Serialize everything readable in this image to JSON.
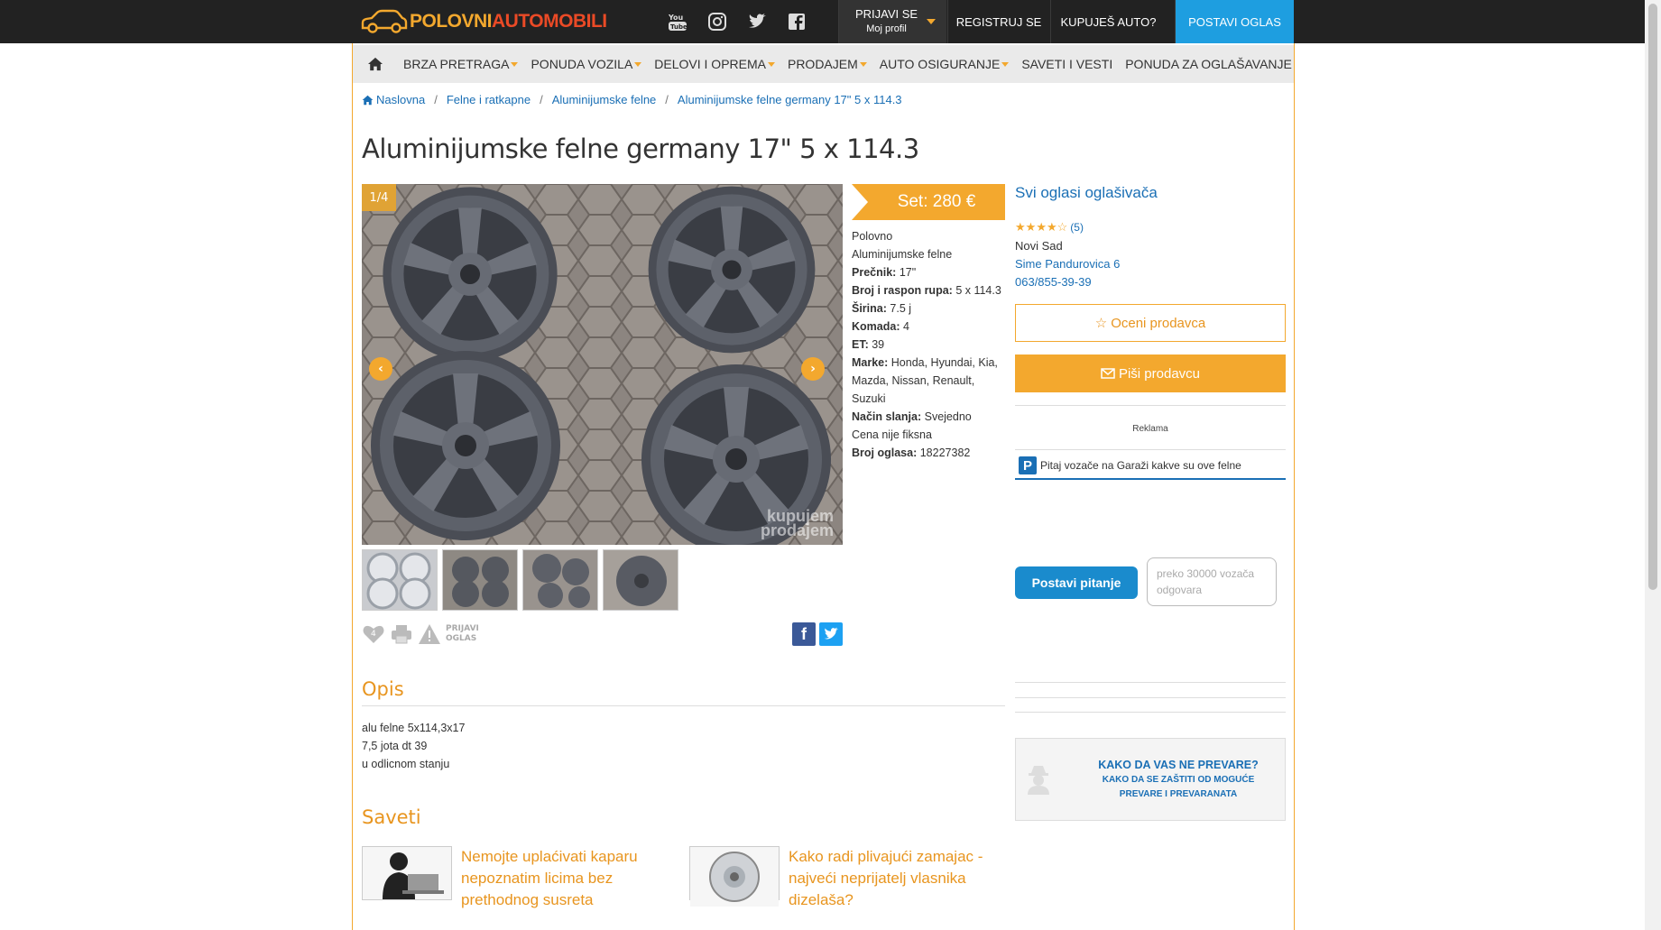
{
  "header": {
    "logo_main": "POLOVNI",
    "logo_accent": "AUTOMOBILI",
    "login_label": "PRIJAVI SE",
    "login_sub": "Moj profil",
    "register_label": "REGISTRUJ SE",
    "buy_label": "KUPUJEŠ AUTO?",
    "post_label": "POSTAVI OGLAS",
    "social_icons": [
      "youtube-icon",
      "instagram-icon",
      "twitter-icon",
      "facebook-icon"
    ]
  },
  "nav": {
    "items": [
      {
        "label": "BRZA PRETRAGA",
        "caret": true
      },
      {
        "label": "PONUDA VOZILA",
        "caret": true
      },
      {
        "label": "DELOVI I OPREMA",
        "caret": true
      },
      {
        "label": "PRODAJEM",
        "caret": true
      },
      {
        "label": "AUTO OSIGURANJE",
        "caret": true
      },
      {
        "label": "SAVETI I VESTI",
        "caret": false
      },
      {
        "label": "PONUDA ZA OGLAŠAVANJE",
        "caret": false
      }
    ]
  },
  "breadcrumb": [
    "Naslovna",
    "Felne i ratkapne",
    "Aluminijumske felne",
    "Aluminijumske felne germany 17\" 5 x 114.3"
  ],
  "title": "Aluminijumske felne germany 17\" 5 x 114.3",
  "gallery": {
    "counter": "1/4",
    "watermark_1": "kupujem",
    "watermark_2": "prodajem",
    "thumb_count": 4
  },
  "tools": {
    "report_1": "PRIJAVI",
    "report_2": "OGLAS"
  },
  "price": "Set: 280 €",
  "details": {
    "condition": "Polovno",
    "category": "Aluminijumske felne",
    "rows": [
      {
        "k": "Prečnik:",
        "v": "17\""
      },
      {
        "k": "Broj i raspon rupa:",
        "v": "5 x 114.3"
      },
      {
        "k": "Širina:",
        "v": "7.5 j"
      },
      {
        "k": "Komada:",
        "v": "4"
      },
      {
        "k": "ET:",
        "v": "39"
      },
      {
        "k": "Marke:",
        "v": "Honda, Hyundai, Kia, Mazda, Nissan, Renault, Suzuki"
      },
      {
        "k": "Način slanja:",
        "v": "Svejedno"
      }
    ],
    "fixed": "Cena nije fiksna",
    "ad_label": "Broj oglasa:",
    "ad_number": "18227382"
  },
  "seller": {
    "all_ads": "Svi oglasi oglašivača",
    "rating": 4,
    "rating_count": "(5)",
    "city": "Novi Sad",
    "address": "Sime Pandurovica 6",
    "phone": "063/855-39-39",
    "rate_label": "Oceni prodavca",
    "write_label": "Piši prodavcu",
    "ad_label": "Reklama",
    "garage_text": "Pitaj vozače na Garaži kakve su ove felne",
    "ask_label": "Postavi pitanje",
    "ask_note": "preko 30000 vozača odgovara",
    "warn_title": "KAKO DA VAS NE PREVARE?",
    "warn_sub": "KAKO DA SE ZAŠTITI OD MOGUĆE PREVARE I PREVARANATA"
  },
  "description": {
    "title": "Opis",
    "lines": [
      "alu felne 5x114,3x17",
      "7,5 jota dt 39",
      "u odlicnom stanju"
    ]
  },
  "tips": {
    "title": "Saveti",
    "items": [
      "Nemojte uplaćivati kaparu nepoznatim licima bez prethodnog susreta",
      "Kako radi plivajući zamajac - najveći neprijatelj vlasnika dizelaša?"
    ]
  },
  "colors": {
    "accent": "#f3a82e",
    "link": "#1a6fb5",
    "post": "#1e9ee0",
    "topbar": "#222222"
  }
}
